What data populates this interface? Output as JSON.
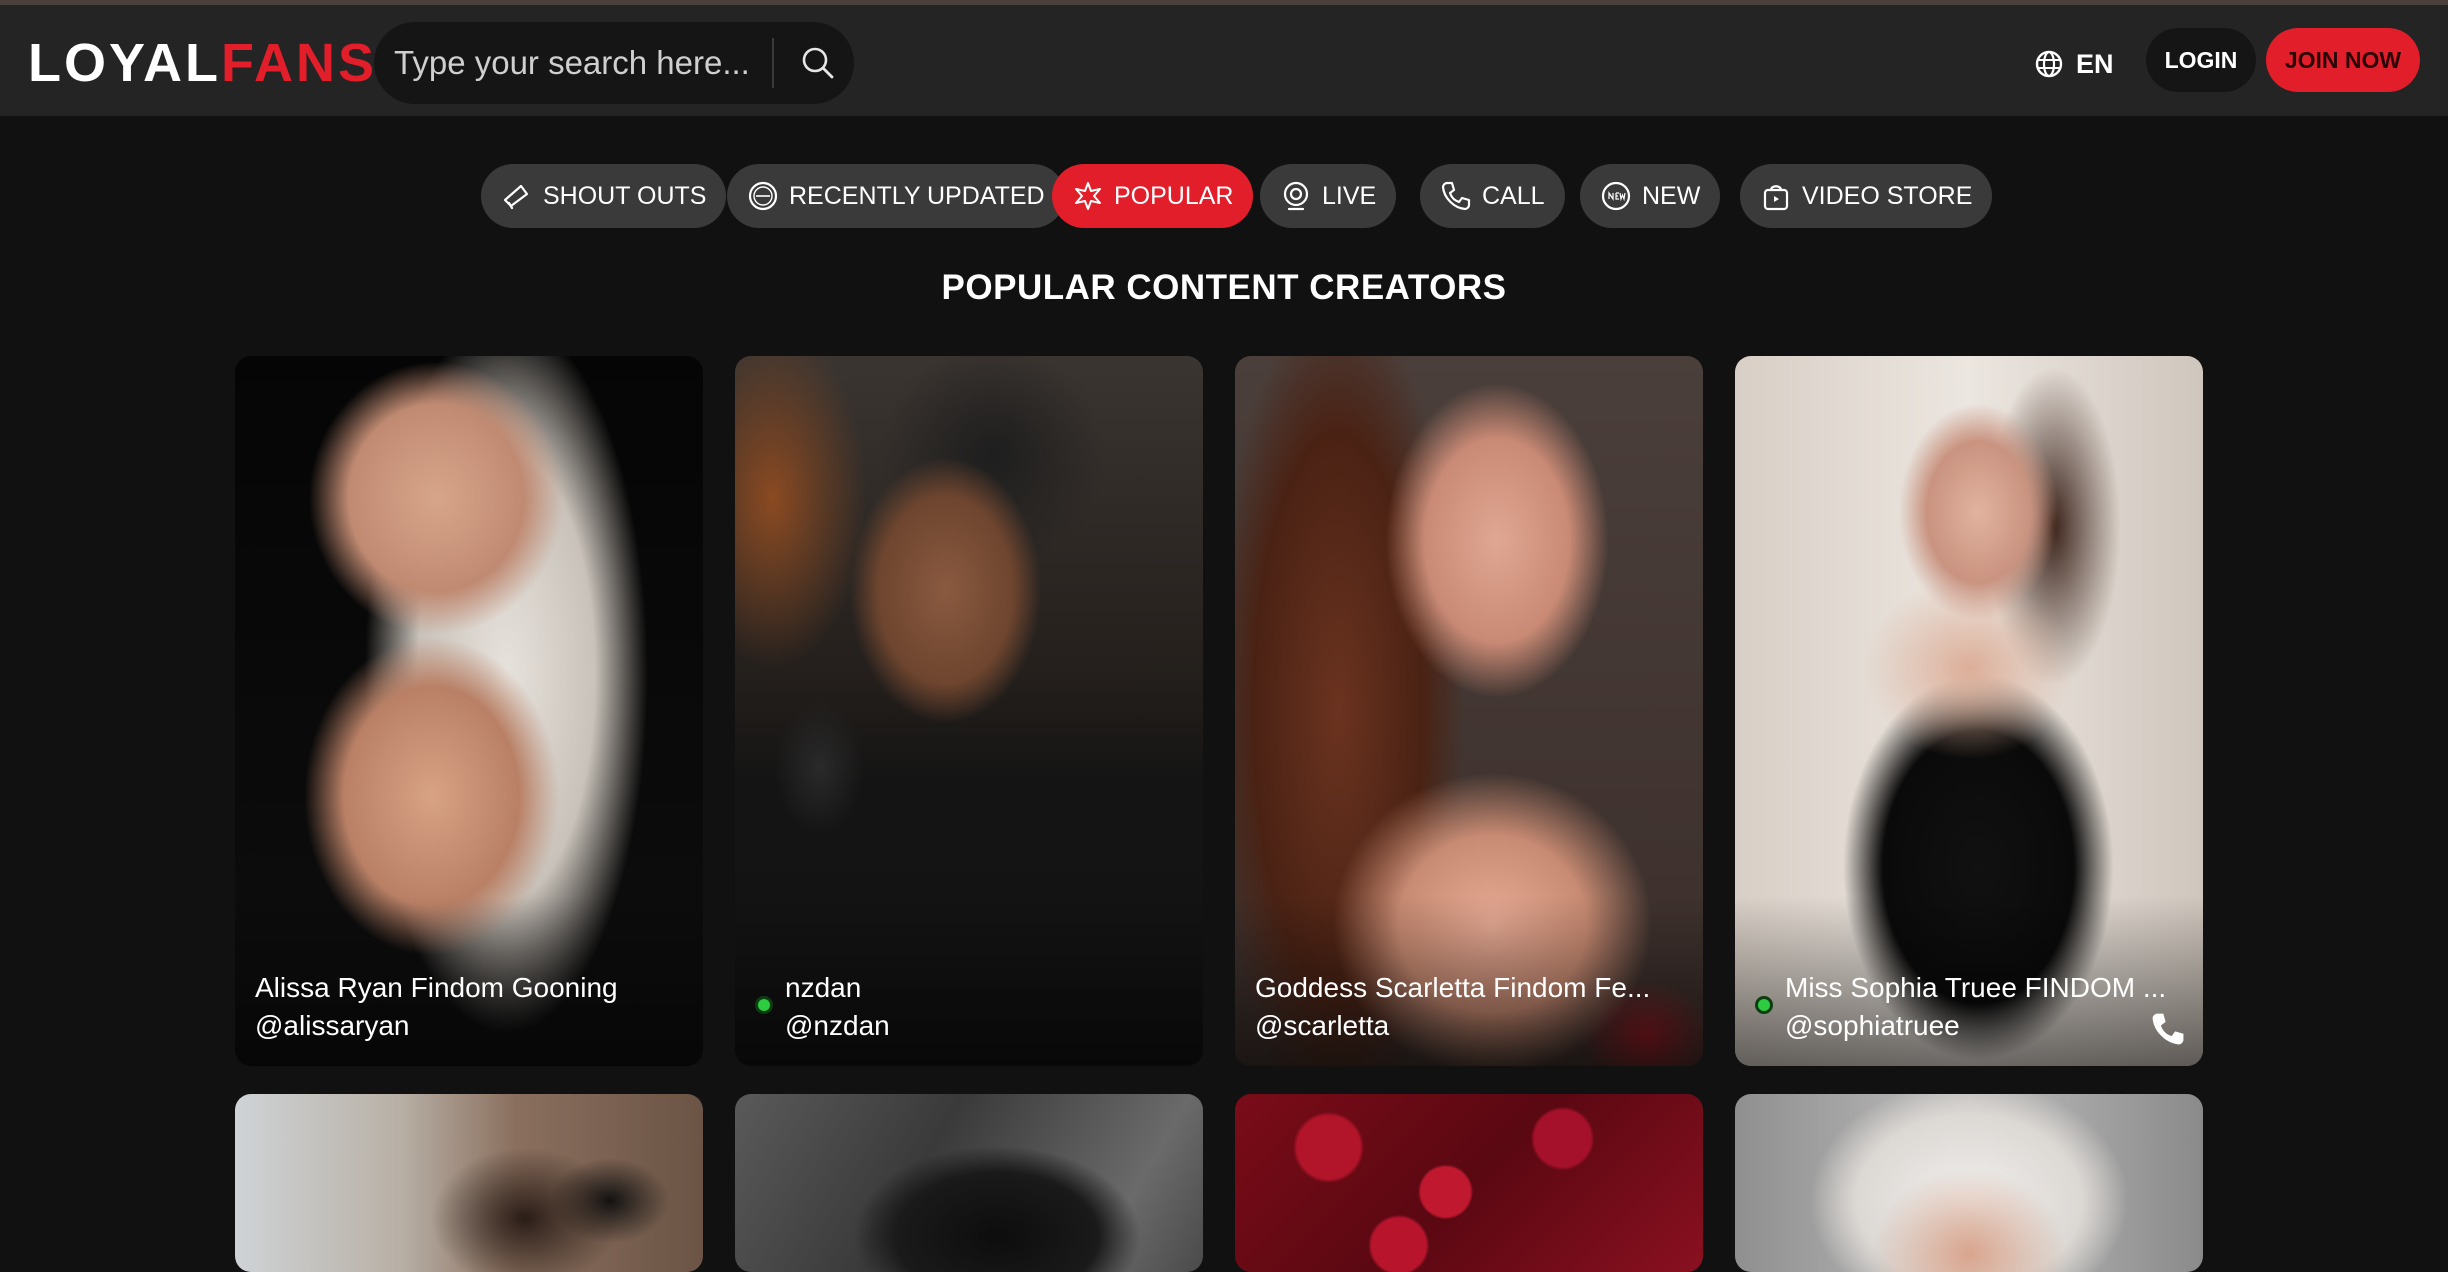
{
  "brand": {
    "logo_part1": "LOYAL",
    "logo_part2": "FANS",
    "accent": "#e21e2a"
  },
  "search": {
    "placeholder": "Type your search here..."
  },
  "header": {
    "language": "EN",
    "login_label": "LOGIN",
    "join_label": "JOIN NOW"
  },
  "tabs": [
    {
      "label": "SHOUT OUTS",
      "icon": "megaphone-icon",
      "active": false
    },
    {
      "label": "RECENTLY UPDATED",
      "icon": "updated-badge-icon",
      "active": false
    },
    {
      "label": "POPULAR",
      "icon": "popular-burst-icon",
      "active": true
    },
    {
      "label": "LIVE",
      "icon": "webcam-icon",
      "active": false
    },
    {
      "label": "CALL",
      "icon": "phone-icon",
      "active": false
    },
    {
      "label": "NEW",
      "icon": "new-badge-icon",
      "active": false
    },
    {
      "label": "VIDEO STORE",
      "icon": "shopping-bag-icon",
      "active": false
    }
  ],
  "section": {
    "title": "POPULAR CONTENT CREATORS"
  },
  "creators": [
    {
      "name": "Alissa Ryan Findom Gooning",
      "handle": "@alissaryan",
      "online": false,
      "call": false
    },
    {
      "name": "nzdan",
      "handle": "@nzdan",
      "online": true,
      "call": false
    },
    {
      "name": "Goddess Scarletta Findom Fe...",
      "handle": "@scarletta",
      "online": false,
      "call": false
    },
    {
      "name": "Miss Sophia Truee FINDOM ...",
      "handle": "@sophiatruee",
      "online": true,
      "call": true
    },
    {
      "name": "",
      "handle": "",
      "online": false,
      "call": false
    },
    {
      "name": "",
      "handle": "",
      "online": false,
      "call": false
    },
    {
      "name": "",
      "handle": "",
      "online": false,
      "call": false
    },
    {
      "name": "",
      "handle": "",
      "online": false,
      "call": false
    }
  ]
}
